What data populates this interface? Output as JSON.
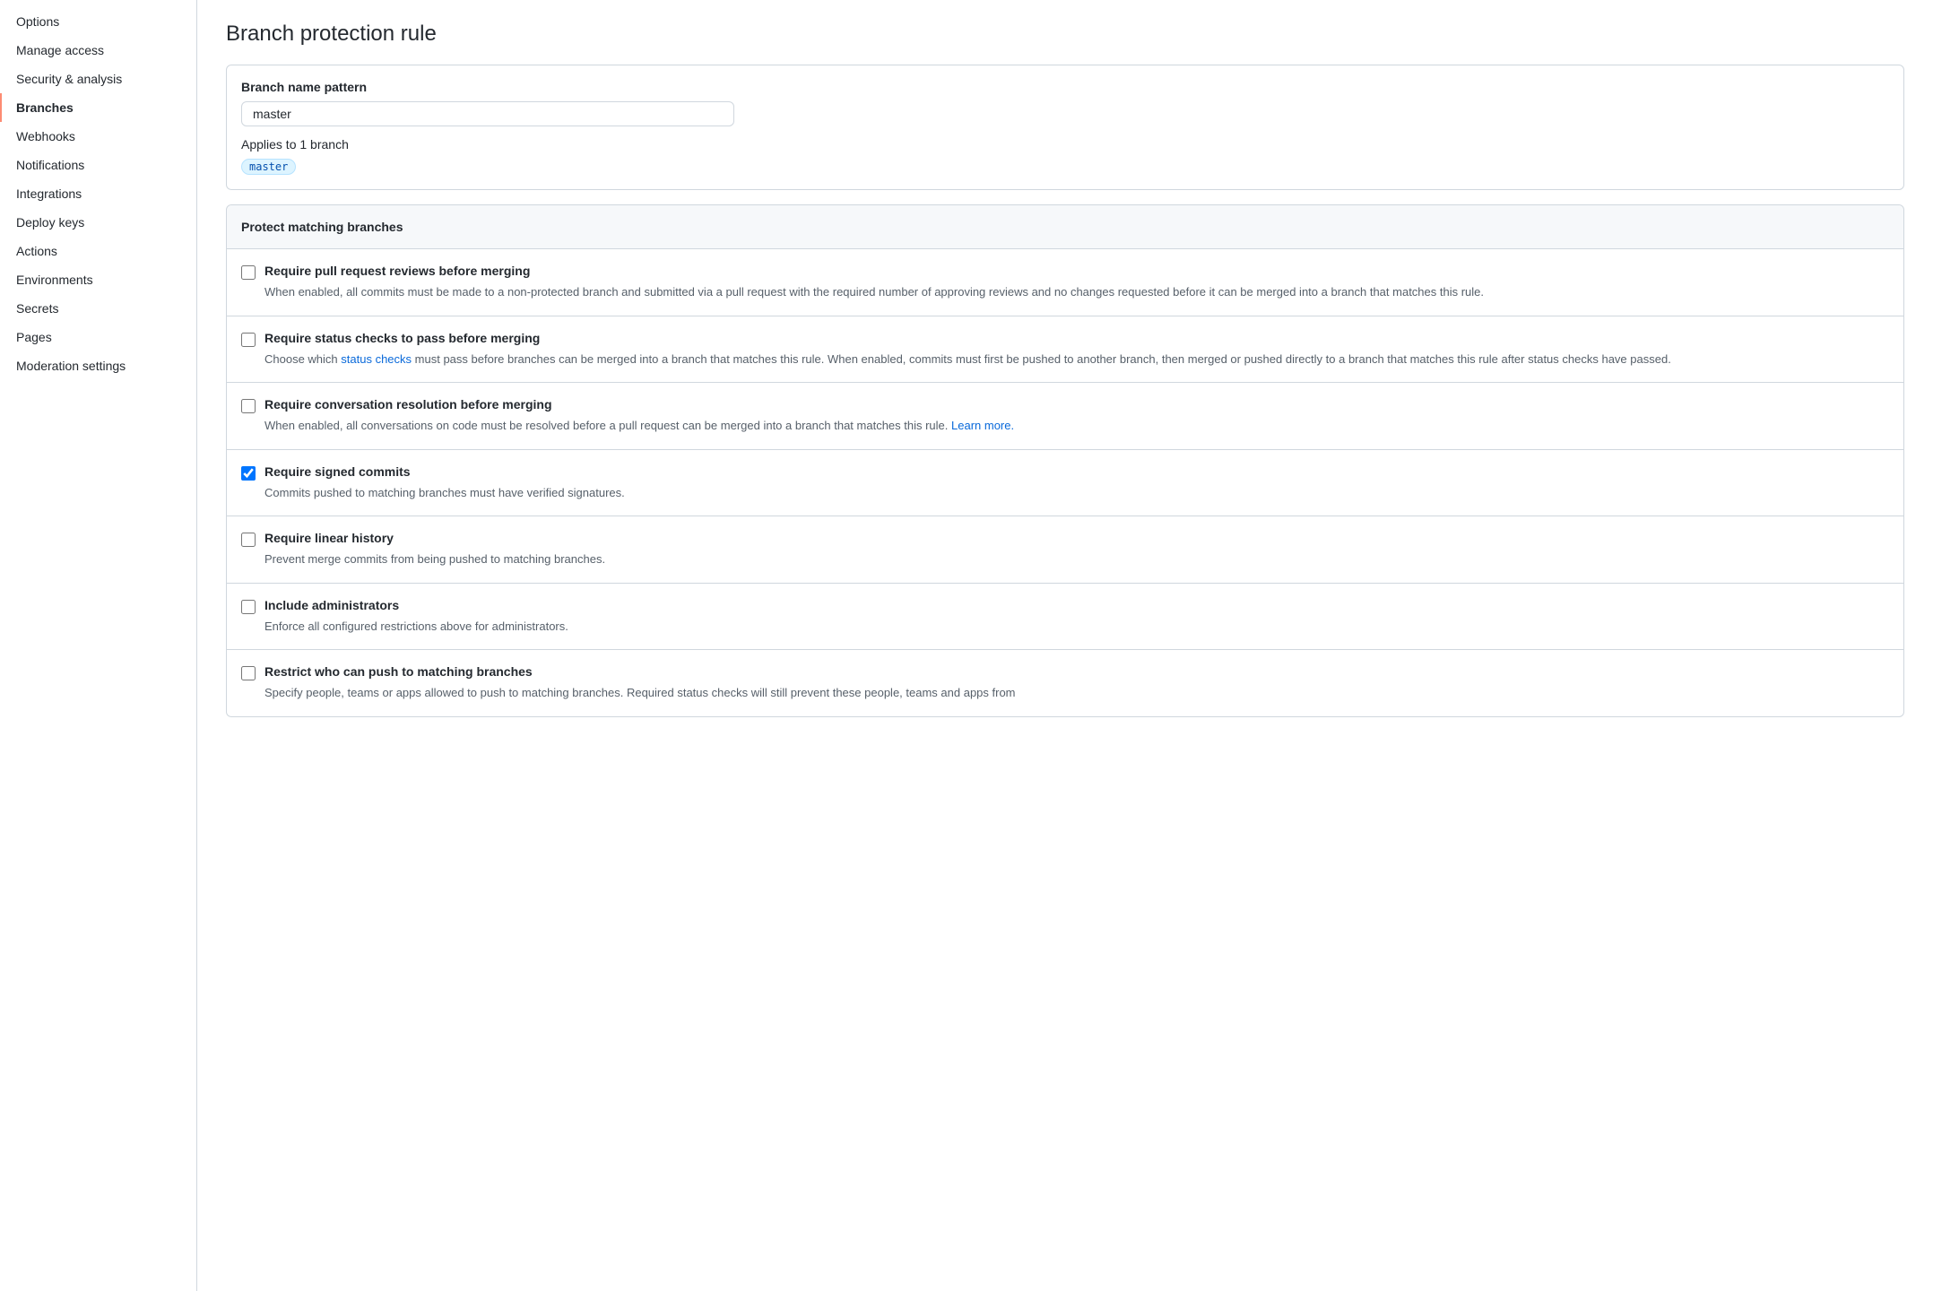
{
  "sidebar": {
    "items": [
      {
        "id": "options",
        "label": "Options",
        "active": false
      },
      {
        "id": "manage-access",
        "label": "Manage access",
        "active": false
      },
      {
        "id": "security-analysis",
        "label": "Security & analysis",
        "active": false
      },
      {
        "id": "branches",
        "label": "Branches",
        "active": true
      },
      {
        "id": "webhooks",
        "label": "Webhooks",
        "active": false
      },
      {
        "id": "notifications",
        "label": "Notifications",
        "active": false
      },
      {
        "id": "integrations",
        "label": "Integrations",
        "active": false
      },
      {
        "id": "deploy-keys",
        "label": "Deploy keys",
        "active": false
      },
      {
        "id": "actions",
        "label": "Actions",
        "active": false
      },
      {
        "id": "environments",
        "label": "Environments",
        "active": false
      },
      {
        "id": "secrets",
        "label": "Secrets",
        "active": false
      },
      {
        "id": "pages",
        "label": "Pages",
        "active": false
      },
      {
        "id": "moderation-settings",
        "label": "Moderation settings",
        "active": false
      }
    ]
  },
  "main": {
    "page_title": "Branch protection rule",
    "branch_name_section": {
      "label": "Branch name pattern",
      "input_value": "master",
      "applies_text": "Applies to 1 branch",
      "branch_tag": "master"
    },
    "protect_section": {
      "header": "Protect matching branches",
      "rules": [
        {
          "id": "require-pr-reviews",
          "checked": false,
          "title": "Require pull request reviews before merging",
          "description": "When enabled, all commits must be made to a non-protected branch and submitted via a pull request with the required number of approving reviews and no changes requested before it can be merged into a branch that matches this rule.",
          "link": null,
          "link_text": null
        },
        {
          "id": "require-status-checks",
          "checked": false,
          "title": "Require status checks to pass before merging",
          "description_before": "Choose which ",
          "link": "status checks",
          "description_after": " must pass before branches can be merged into a branch that matches this rule. When enabled, commits must first be pushed to another branch, then merged or pushed directly to a branch that matches this rule after status checks have passed.",
          "link_text": "status checks"
        },
        {
          "id": "require-conversation-resolution",
          "checked": false,
          "title": "Require conversation resolution before merging",
          "description": "When enabled, all conversations on code must be resolved before a pull request can be merged into a branch that matches this rule.",
          "link": "Learn more.",
          "link_text": "Learn more."
        },
        {
          "id": "require-signed-commits",
          "checked": true,
          "title": "Require signed commits",
          "description": "Commits pushed to matching branches must have verified signatures.",
          "link": null
        },
        {
          "id": "require-linear-history",
          "checked": false,
          "title": "Require linear history",
          "description": "Prevent merge commits from being pushed to matching branches.",
          "link": null
        },
        {
          "id": "include-administrators",
          "checked": false,
          "title": "Include administrators",
          "description": "Enforce all configured restrictions above for administrators.",
          "link": null
        },
        {
          "id": "restrict-who-can-push",
          "checked": false,
          "title": "Restrict who can push to matching branches",
          "description": "Specify people, teams or apps allowed to push to matching branches. Required status checks will still prevent these people, teams and apps from",
          "link": null
        }
      ]
    }
  }
}
